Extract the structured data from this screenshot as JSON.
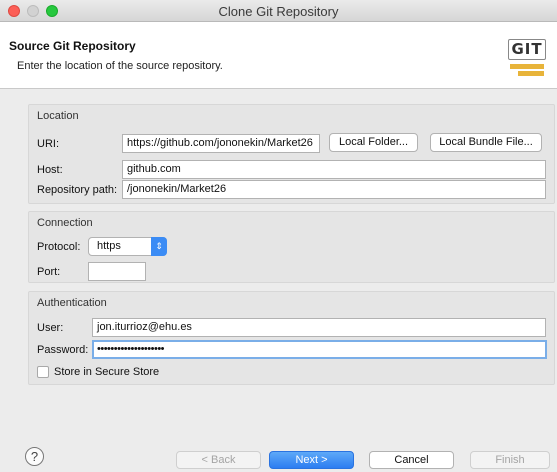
{
  "window": {
    "title": "Clone Git Repository"
  },
  "header": {
    "title": "Source Git Repository",
    "description": "Enter the location of the source repository.",
    "logo_text": "GIT"
  },
  "location": {
    "group_label": "Location",
    "uri_label": "URI:",
    "uri_value": "https://github.com/jononekin/Market26",
    "local_folder_button": "Local Folder...",
    "local_bundle_button": "Local Bundle File...",
    "host_label": "Host:",
    "host_value": "github.com",
    "repo_path_label": "Repository path:",
    "repo_path_value": "/jononekin/Market26"
  },
  "connection": {
    "group_label": "Connection",
    "protocol_label": "Protocol:",
    "protocol_value": "https",
    "port_label": "Port:",
    "port_value": ""
  },
  "authentication": {
    "group_label": "Authentication",
    "user_label": "User:",
    "user_value": "jon.iturrioz@ehu.es",
    "password_label": "Password:",
    "password_value": "••••••••••••••••••••",
    "store_label": "Store in Secure Store"
  },
  "footer": {
    "help_label": "?",
    "back_button": "< Back",
    "next_button": "Next >",
    "cancel_button": "Cancel",
    "finish_button": "Finish"
  },
  "colors": {
    "accent": "#2c7df1",
    "focus_ring": "#7aaee8",
    "close": "#fc5f57",
    "maximize": "#27c83f",
    "git_logo_bar": "#e8b43a"
  }
}
